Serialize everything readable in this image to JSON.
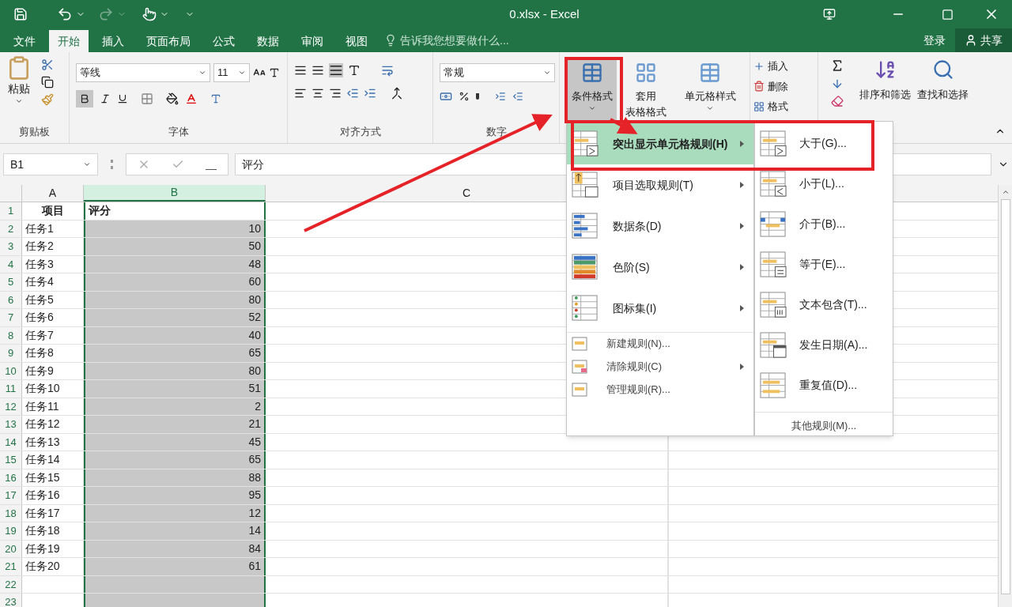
{
  "window": {
    "title": "0.xlsx - Excel"
  },
  "tabs": [
    {
      "label": "文件",
      "selected": false
    },
    {
      "label": "开始",
      "selected": true
    },
    {
      "label": "插入",
      "selected": false
    },
    {
      "label": "页面布局",
      "selected": false
    },
    {
      "label": "公式",
      "selected": false
    },
    {
      "label": "数据",
      "selected": false
    },
    {
      "label": "审阅",
      "selected": false
    },
    {
      "label": "视图",
      "selected": false
    }
  ],
  "tell_me": {
    "placeholder": "告诉我您想要做什么..."
  },
  "account": {
    "sign_in": "登录",
    "share": "共享"
  },
  "ribbon": {
    "clipboard": {
      "paste": "粘贴",
      "label": "剪贴板"
    },
    "font": {
      "name": "等线",
      "size": "11",
      "label": "字体"
    },
    "alignment": {
      "label": "对齐方式"
    },
    "number": {
      "format": "常规",
      "label": "数字"
    },
    "styles": {
      "conditional": "条件格式",
      "table_lines": [
        "套用",
        "表格格式"
      ],
      "cell_styles": "单元格样式"
    },
    "cells": {
      "insert": "插入",
      "delete": "删除",
      "format": "格式"
    },
    "editing": {
      "sort": "排序和筛选",
      "find": "查找和选择"
    }
  },
  "formula_bar": {
    "name_box": "B1",
    "value": "评分"
  },
  "columns": [
    {
      "label": "A",
      "selected": false
    },
    {
      "label": "B",
      "selected": true
    },
    {
      "label": "C",
      "selected": false
    }
  ],
  "rows": [
    {
      "number": "1",
      "kind": "header",
      "active": true,
      "cells": [
        "项目",
        "评分"
      ]
    },
    {
      "number": "2",
      "kind": "data",
      "active": false,
      "cells": [
        "任务1",
        "10"
      ]
    },
    {
      "number": "3",
      "kind": "data",
      "active": false,
      "cells": [
        "任务2",
        "50"
      ]
    },
    {
      "number": "4",
      "kind": "data",
      "active": false,
      "cells": [
        "任务3",
        "48"
      ]
    },
    {
      "number": "5",
      "kind": "data",
      "active": false,
      "cells": [
        "任务4",
        "60"
      ]
    },
    {
      "number": "6",
      "kind": "data",
      "active": false,
      "cells": [
        "任务5",
        "80"
      ]
    },
    {
      "number": "7",
      "kind": "data",
      "active": false,
      "cells": [
        "任务6",
        "52"
      ]
    },
    {
      "number": "8",
      "kind": "data",
      "active": false,
      "cells": [
        "任务7",
        "40"
      ]
    },
    {
      "number": "9",
      "kind": "data",
      "active": false,
      "cells": [
        "任务8",
        "65"
      ]
    },
    {
      "number": "10",
      "kind": "data",
      "active": false,
      "cells": [
        "任务9",
        "80"
      ]
    },
    {
      "number": "11",
      "kind": "data",
      "active": false,
      "cells": [
        "任务10",
        "51"
      ]
    },
    {
      "number": "12",
      "kind": "data",
      "active": false,
      "cells": [
        "任务11",
        "2"
      ]
    },
    {
      "number": "13",
      "kind": "data",
      "active": false,
      "cells": [
        "任务12",
        "21"
      ]
    },
    {
      "number": "14",
      "kind": "data",
      "active": false,
      "cells": [
        "任务13",
        "45"
      ]
    },
    {
      "number": "15",
      "kind": "data",
      "active": false,
      "cells": [
        "任务14",
        "65"
      ]
    },
    {
      "number": "16",
      "kind": "data",
      "active": false,
      "cells": [
        "任务15",
        "88"
      ]
    },
    {
      "number": "17",
      "kind": "data",
      "active": false,
      "cells": [
        "任务16",
        "95"
      ]
    },
    {
      "number": "18",
      "kind": "data",
      "active": false,
      "cells": [
        "任务17",
        "12"
      ]
    },
    {
      "number": "19",
      "kind": "data",
      "active": false,
      "cells": [
        "任务18",
        "14"
      ]
    },
    {
      "number": "20",
      "kind": "data",
      "active": false,
      "cells": [
        "任务19",
        "84"
      ]
    },
    {
      "number": "21",
      "kind": "data",
      "active": false,
      "cells": [
        "任务20",
        "61"
      ]
    },
    {
      "number": "22",
      "kind": "data",
      "active": false,
      "cells": []
    },
    {
      "number": "23",
      "kind": "data",
      "active": false,
      "cells": []
    }
  ],
  "menu": {
    "items": [
      {
        "kind": "rule",
        "label": "突出显示单元格规则(H)",
        "submenu": true,
        "selected": true
      },
      {
        "kind": "rule",
        "label": "项目选取规则(T)",
        "submenu": true,
        "selected": false
      },
      {
        "kind": "rule",
        "label": "数据条(D)",
        "submenu": true,
        "selected": false
      },
      {
        "kind": "rule",
        "label": "色阶(S)",
        "submenu": true,
        "selected": false
      },
      {
        "kind": "rule",
        "label": "图标集(I)",
        "submenu": true,
        "selected": false
      },
      {
        "kind": "small",
        "label": "新建规则(N)...",
        "submenu": false,
        "selected": false
      },
      {
        "kind": "small",
        "label": "清除规则(C)",
        "submenu": true,
        "selected": false
      },
      {
        "kind": "small",
        "label": "管理规则(R)...",
        "submenu": false,
        "selected": false
      }
    ],
    "submenu": [
      {
        "kind": "rule",
        "label": "大于(G)..."
      },
      {
        "kind": "rule",
        "label": "小于(L)..."
      },
      {
        "kind": "rule",
        "label": "介于(B)..."
      },
      {
        "kind": "rule",
        "label": "等于(E)..."
      },
      {
        "kind": "rule",
        "label": "文本包含(T)..."
      },
      {
        "kind": "rule",
        "label": "发生日期(A)..."
      },
      {
        "kind": "rule",
        "label": "重复值(D)..."
      },
      {
        "kind": "more",
        "label": "其他规则(M)..."
      }
    ]
  }
}
